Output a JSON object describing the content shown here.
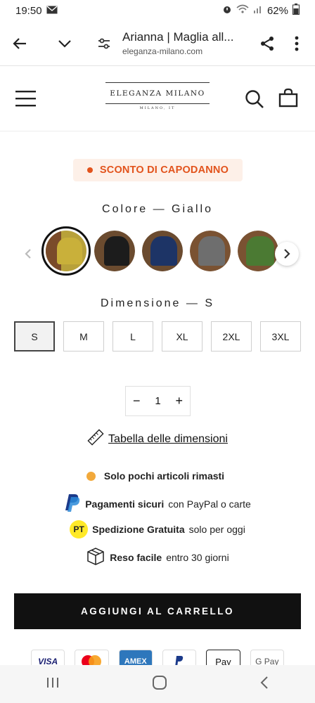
{
  "status": {
    "time": "19:50",
    "battery": "62%"
  },
  "browser": {
    "title": "Arianna | Maglia all...",
    "domain": "eleganza-milano.com"
  },
  "logo": {
    "name": "ELEGANZA MILANO",
    "sub": "MILANO, IT"
  },
  "promo": {
    "label": "SCONTO DI CAPODANNO"
  },
  "color": {
    "label": "Colore — Giallo",
    "swatches": [
      {
        "name": "Giallo",
        "color": "#b8a13a",
        "selected": true
      },
      {
        "name": "Nero",
        "color": "#1c1c1c"
      },
      {
        "name": "Blu",
        "color": "#1d3466"
      },
      {
        "name": "Grigio",
        "color": "#6e6e6e"
      },
      {
        "name": "Verde",
        "color": "#4b7a33"
      }
    ]
  },
  "size": {
    "label": "Dimensione — S",
    "options": [
      "S",
      "M",
      "L",
      "XL",
      "2XL",
      "3XL"
    ],
    "selected": "S"
  },
  "quantity": {
    "minus": "−",
    "value": "1",
    "plus": "+"
  },
  "size_table": {
    "label": "Tabella delle dimensioni"
  },
  "features": [
    {
      "bold": "Solo pochi articoli rimasti",
      "rest": ""
    },
    {
      "bold": "Pagamenti sicuri",
      "rest": "con PayPal o carte"
    },
    {
      "bold": "Spedizione Gratuita",
      "rest": "solo per oggi"
    },
    {
      "bold": "Reso facile",
      "rest": "entro 30 giorni"
    }
  ],
  "feature_icons": {
    "pt_badge": "PT"
  },
  "cart": {
    "label": "AGGIUNGI AL CARRELLO"
  },
  "payments": [
    "VISA",
    "",
    "AMEX",
    "",
    "Pay",
    "G Pay"
  ],
  "colors": {
    "accent": "#e2531c",
    "promo_bg": "#fdf0e8",
    "cart_bg": "#111111",
    "stock_dot": "#f2a93b"
  }
}
